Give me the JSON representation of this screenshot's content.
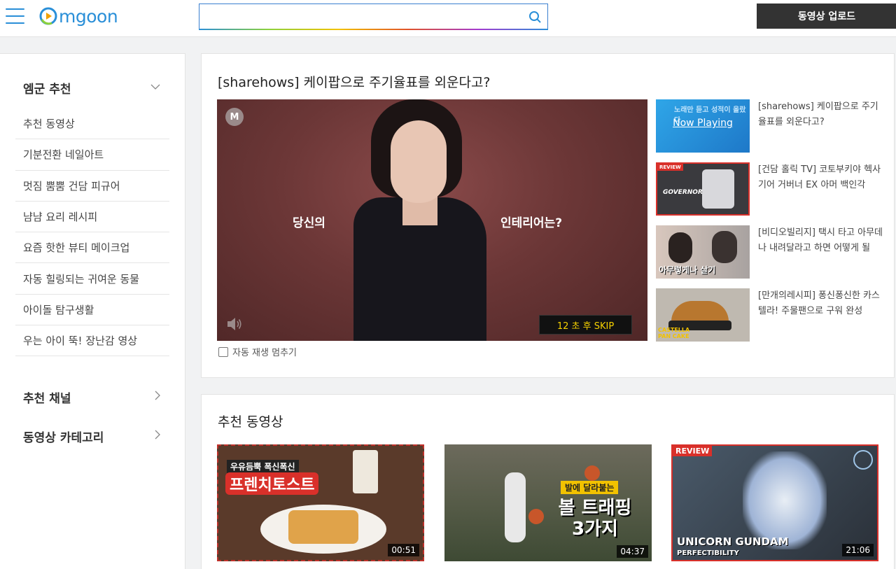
{
  "header": {
    "logo_text": "mgoon",
    "search_placeholder": "",
    "upload_label": "동영상 업로드"
  },
  "sidebar": {
    "section_recommend": "엠군 추천",
    "items": [
      {
        "label": "추천 동영상"
      },
      {
        "label": "기분전환 네일아트"
      },
      {
        "label": "멋짐 뿜뿜 건담 피규어"
      },
      {
        "label": "냠냠 요리 레시피"
      },
      {
        "label": "요즘 핫한 뷰티 메이크업"
      },
      {
        "label": "자동 힐링되는 귀여운 동물"
      },
      {
        "label": "아이돌 탐구생활"
      },
      {
        "label": "우는 아이 뚝! 장난감 영상"
      }
    ],
    "section_channels": "추천 채널",
    "section_categories": "동영상 카테고리"
  },
  "player": {
    "title": "[sharehows] 케이팝으로 주기율표를 외운다고?",
    "badge": "M",
    "ad_text_left": "당신의",
    "ad_text_right": "인테리어는?",
    "skip_label": "12 초 후 SKIP",
    "autoplay_label": "자동 재생 멈추기"
  },
  "playlist": [
    {
      "title": "[sharehows] 케이팝으로 주기율표를 외운다고?",
      "overlay": "Now Playing",
      "thumb_caption": "노래만 듣고 성적이 올랐다"
    },
    {
      "title": "[건담 홀릭 TV] 코토부키야 헥사기어 거버너 EX 아머 백인각",
      "thumb_caption": "GOVERNOR",
      "thumb_badge": "REVIEW"
    },
    {
      "title": "[비디오빌리지] 택시 타고 아무데나 내려달라고 하면 어떻게 될",
      "thumb_caption": "아무렇게나 살기"
    },
    {
      "title": "[만개의레시피] 퐁신퐁신한 카스텔라! 주물팬으로 구워 완성",
      "thumb_caption": "CASTELLA PAN CAKE"
    }
  ],
  "recommended": {
    "title": "추천 동영상",
    "videos": [
      {
        "duration": "00:51",
        "caption_top": "우유듬뿍 폭신폭신",
        "caption_main": "프렌치토스트"
      },
      {
        "duration": "04:37",
        "caption_top": "발에 달라붙는",
        "caption_main": "볼 트래핑 3가지"
      },
      {
        "duration": "21:06",
        "caption_top": "REVIEW",
        "caption_main": "UNICORN GUNDAM",
        "caption_sub": "PERFECTIBILITY"
      }
    ]
  },
  "colors": {
    "brand": "#2a8fd8",
    "skip_text": "#f6d100",
    "header_button": "#333333"
  }
}
